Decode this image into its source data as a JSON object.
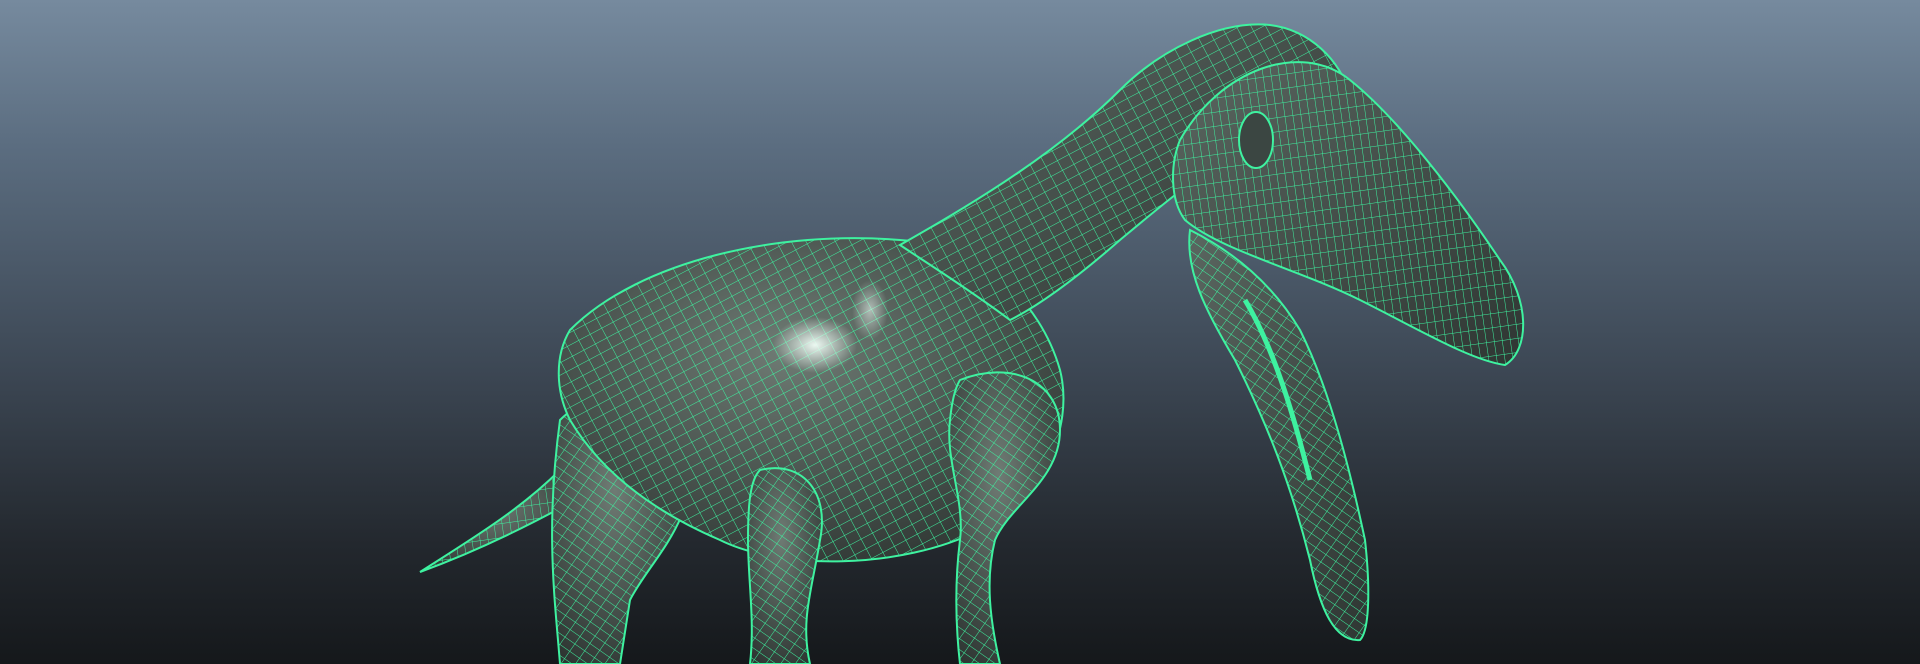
{
  "viewport": {
    "shading_mode": "wireframe-on-shaded",
    "background_gradient": [
      "#768a9e",
      "#5b6d80",
      "#3d4855",
      "#23282e",
      "#15181b"
    ]
  },
  "model": {
    "subject": "quadruped-creature-mesh",
    "wireframe_color": "#3ef2a0",
    "surface_color": "#4a5550",
    "highlight_color": "#e6f2ec"
  }
}
